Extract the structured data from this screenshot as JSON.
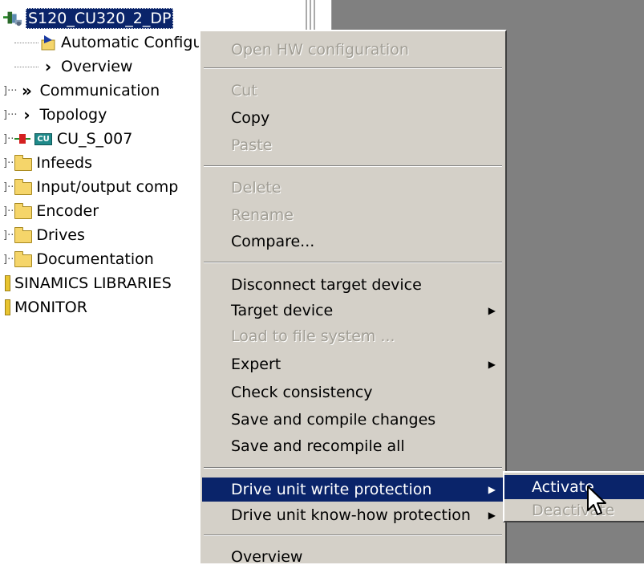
{
  "tree": {
    "items": [
      {
        "label": "S120_CU320_2_DP",
        "icon": "drive-unit-icon",
        "selected": true
      },
      {
        "label": "Automatic Configu",
        "icon": "auto-config-icon"
      },
      {
        "label": "Overview",
        "icon": "chevron-right-icon"
      },
      {
        "label": "Communication",
        "icon": "double-chevron-icon"
      },
      {
        "label": "Topology",
        "icon": "chevron-right-icon"
      },
      {
        "label": "CU_S_007",
        "icon": "control-unit-icon",
        "badge": "CU"
      },
      {
        "label": "Infeeds",
        "icon": "folder-icon"
      },
      {
        "label": "Input/output comp",
        "icon": "folder-icon"
      },
      {
        "label": "Encoder",
        "icon": "folder-icon"
      },
      {
        "label": "Drives",
        "icon": "folder-icon"
      },
      {
        "label": "Documentation",
        "icon": "folder-icon"
      },
      {
        "label": "SINAMICS LIBRARIES",
        "icon": "library-icon"
      },
      {
        "label": "MONITOR",
        "icon": "library-icon"
      }
    ]
  },
  "context_menu": {
    "items": [
      {
        "label": "Open HW configuration",
        "enabled": false
      },
      {
        "label": "Cut",
        "enabled": false
      },
      {
        "label": "Copy",
        "enabled": true
      },
      {
        "label": "Paste",
        "enabled": false
      },
      {
        "label": "Delete",
        "enabled": false
      },
      {
        "label": "Rename",
        "enabled": false
      },
      {
        "label": "Compare...",
        "enabled": true
      },
      {
        "label": "Disconnect target device",
        "enabled": true
      },
      {
        "label": "Target device",
        "enabled": true,
        "submenu": true
      },
      {
        "label": "Load to file system ...",
        "enabled": false
      },
      {
        "label": "Expert",
        "enabled": true,
        "submenu": true
      },
      {
        "label": "Check consistency",
        "enabled": true
      },
      {
        "label": "Save and compile changes",
        "enabled": true
      },
      {
        "label": "Save and recompile all",
        "enabled": true
      },
      {
        "label": "Drive unit write protection",
        "enabled": true,
        "submenu": true,
        "highlighted": true
      },
      {
        "label": "Drive unit know-how protection",
        "enabled": true,
        "submenu": true
      },
      {
        "label": "Overview",
        "enabled": true
      }
    ]
  },
  "submenu": {
    "items": [
      {
        "label": "Activate",
        "enabled": true,
        "highlighted": true
      },
      {
        "label": "Deactivate",
        "enabled": false
      }
    ]
  },
  "colors": {
    "menu_bg": "#d4d0c8",
    "highlight": "#0a246a",
    "workspace": "#808080",
    "disabled_text": "#a19e95"
  }
}
